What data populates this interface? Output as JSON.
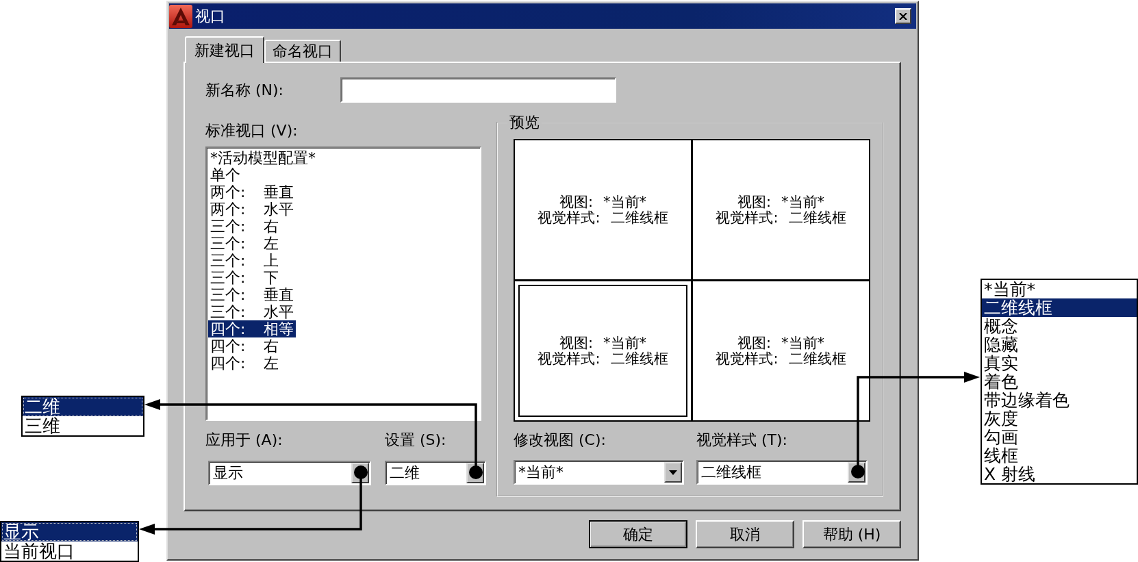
{
  "window": {
    "title": "视口"
  },
  "tabs": [
    {
      "label": "新建视口",
      "selected": true
    },
    {
      "label": "命名视口",
      "selected": false
    }
  ],
  "new_name": {
    "label": "新名称 (N):"
  },
  "standard_viewports": {
    "label": "标准视口 (V):",
    "items": [
      {
        "text": "*活动模型配置*",
        "selected": false
      },
      {
        "text": "单个",
        "selected": false
      },
      {
        "text": "两个: 垂直",
        "selected": false
      },
      {
        "text": "两个: 水平",
        "selected": false
      },
      {
        "text": "三个: 右",
        "selected": false
      },
      {
        "text": "三个: 左",
        "selected": false
      },
      {
        "text": "三个: 上",
        "selected": false
      },
      {
        "text": "三个: 下",
        "selected": false
      },
      {
        "text": "三个: 垂直",
        "selected": false
      },
      {
        "text": "三个: 水平",
        "selected": false
      },
      {
        "text": "四个: 相等",
        "selected": true
      },
      {
        "text": "四个: 右",
        "selected": false
      },
      {
        "text": "四个: 左",
        "selected": false
      }
    ]
  },
  "apply_to": {
    "label": "应用于 (A):",
    "value": "显示",
    "options": [
      {
        "text": "显示",
        "selected": true
      },
      {
        "text": "当前视口",
        "selected": false
      }
    ]
  },
  "setup": {
    "label": "设置 (S):",
    "value": "二维",
    "options": [
      {
        "text": "二维",
        "selected": true
      },
      {
        "text": "三维",
        "selected": false
      }
    ]
  },
  "preview": {
    "label": "预览",
    "viewports": [
      {
        "view": "视图: *当前*",
        "style": "视觉样式: 二维线框",
        "selected": false
      },
      {
        "view": "视图: *当前*",
        "style": "视觉样式: 二维线框",
        "selected": false
      },
      {
        "view": "视图: *当前*",
        "style": "视觉样式: 二维线框",
        "selected": true
      },
      {
        "view": "视图: *当前*",
        "style": "视觉样式: 二维线框",
        "selected": false
      }
    ]
  },
  "change_view": {
    "label": "修改视图 (C):",
    "value": "*当前*"
  },
  "visual_style": {
    "label": "视觉样式 (T):",
    "value": "二维线框",
    "options": [
      {
        "text": "*当前*",
        "selected": false
      },
      {
        "text": "二维线框",
        "selected": true
      },
      {
        "text": "概念",
        "selected": false
      },
      {
        "text": "隐藏",
        "selected": false
      },
      {
        "text": "真实",
        "selected": false
      },
      {
        "text": "着色",
        "selected": false
      },
      {
        "text": "带边缘着色",
        "selected": false
      },
      {
        "text": "灰度",
        "selected": false
      },
      {
        "text": "勾画",
        "selected": false
      },
      {
        "text": "线框",
        "selected": false
      },
      {
        "text": "X 射线",
        "selected": false
      }
    ]
  },
  "buttons": [
    {
      "label": "确定",
      "default": true
    },
    {
      "label": "取消",
      "default": false
    },
    {
      "label": "帮助 (H)",
      "default": false
    }
  ]
}
